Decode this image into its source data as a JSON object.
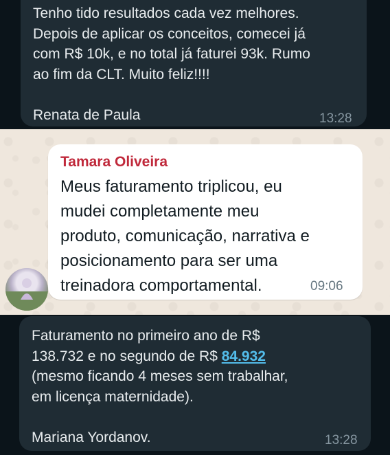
{
  "top_message": {
    "text": "Tenho tido resultados cada vez melhores.\nDepois de aplicar os conceitos, comecei já\ncom R$ 10k, e no total já faturei 93k. Rumo\nao fim da CLT. Muito feliz!!!!\n\nRenata de Paula",
    "time": "13:28"
  },
  "middle_message": {
    "sender": "Tamara Oliveira",
    "text": "Meus faturamento triplicou, eu\nmudei completamente meu\nproduto, comunicação, narrativa e\nposicionamento para ser uma\ntreinadora comportamental.",
    "time": "09:06"
  },
  "bottom_message": {
    "text_before_link": "Faturamento no primeiro ano de R$\n138.732 e no segundo de R$ ",
    "link": "84.932",
    "text_after_link": "\n(mesmo ficando 4 meses sem trabalhar,\nem licença maternidade).\n\nMariana Yordanov.",
    "time": "13:28"
  },
  "colors": {
    "dark_background": "#0b141a",
    "dark_bubble": "#1f2c34",
    "light_background": "#efe7dd",
    "sender_name": "#c0293b",
    "link": "#53bdeb"
  },
  "icons": [
    "avatar"
  ]
}
